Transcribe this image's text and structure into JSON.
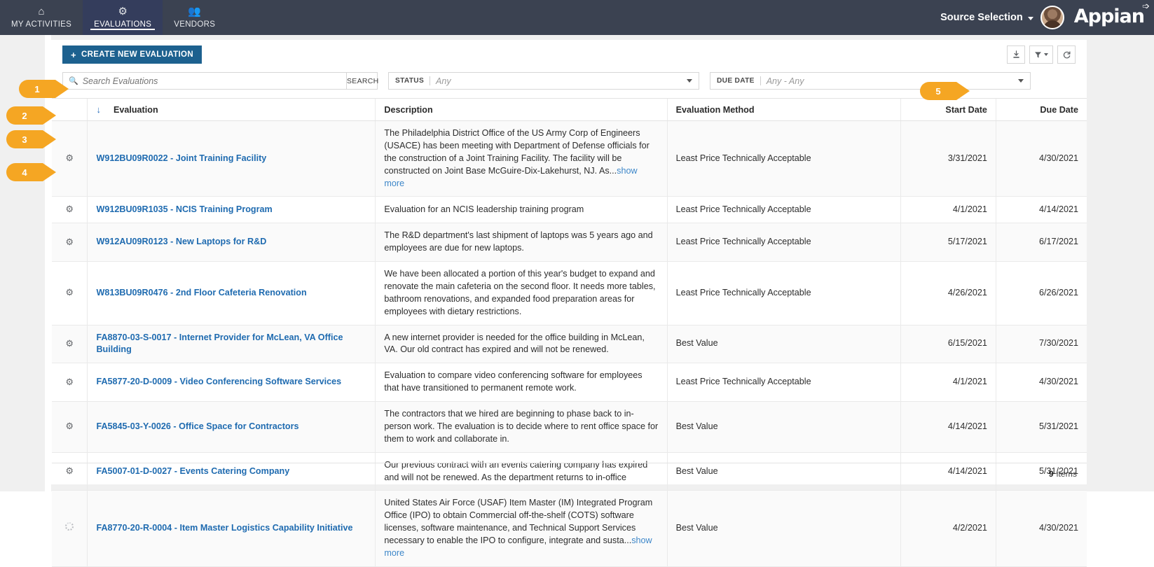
{
  "topnav": {
    "tabs": [
      {
        "label": "MY ACTIVITIES",
        "icon": "home-icon",
        "glyph": "⌂",
        "active": false
      },
      {
        "label": "EVALUATIONS",
        "icon": "gear-icon",
        "glyph": "⚙",
        "active": true
      },
      {
        "label": "VENDORS",
        "icon": "people-icon",
        "glyph": "👥",
        "active": false
      }
    ],
    "source_selection": "Source Selection",
    "brand": "Appian"
  },
  "toolbar": {
    "create_label": "CREATE NEW EVALUATION",
    "create_plus": "+",
    "export_icon": "download-icon",
    "filter_icon": "filter-icon",
    "refresh_icon": "refresh-icon"
  },
  "search": {
    "placeholder": "Search Evaluations",
    "value": "",
    "button_label": "SEARCH",
    "icon": "search-icon"
  },
  "filters": {
    "status": {
      "label": "STATUS",
      "value": "Any"
    },
    "due_date": {
      "label": "DUE DATE",
      "value": "Any - Any"
    }
  },
  "table": {
    "columns": [
      {
        "key": "gear",
        "label": ""
      },
      {
        "key": "evaluation",
        "label": "Evaluation"
      },
      {
        "key": "description",
        "label": "Description"
      },
      {
        "key": "method",
        "label": "Evaluation Method"
      },
      {
        "key": "start",
        "label": "Start Date"
      },
      {
        "key": "due",
        "label": "Due Date"
      }
    ],
    "sort_indicator": "↓",
    "show_more_label": "show more",
    "rows": [
      {
        "row_icon": "gear-icon",
        "name": "W912BU09R0022 - Joint Training Facility",
        "description": "The Philadelphia District Office of the US Army Corp of Engineers (USACE) has been meeting with Department of Defense officials for the construction of a Joint Training Facility. The facility will be constructed on Joint Base McGuire-Dix-Lakehurst, NJ. As...",
        "truncated": true,
        "method": "Least Price Technically Acceptable",
        "start": "3/31/2021",
        "due": "4/30/2021"
      },
      {
        "row_icon": "gear-icon",
        "name": "W912BU09R1035 - NCIS Training Program",
        "description": "Evaluation for an NCIS leadership training program",
        "truncated": false,
        "method": "Least Price Technically Acceptable",
        "start": "4/1/2021",
        "due": "4/14/2021"
      },
      {
        "row_icon": "gear-icon",
        "name": "W912AU09R0123 - New Laptops for R&D",
        "description": "The R&D department's last shipment of laptops was 5 years ago and employees are due for new laptops.",
        "truncated": false,
        "method": "Least Price Technically Acceptable",
        "start": "5/17/2021",
        "due": "6/17/2021"
      },
      {
        "row_icon": "gear-icon",
        "name": "W813BU09R0476 - 2nd Floor Cafeteria Renovation",
        "description": "We have been allocated a portion of this year's budget to expand and renovate the main cafeteria on the second floor. It needs more tables, bathroom renovations, and expanded food preparation areas for employees with dietary restrictions.",
        "truncated": false,
        "method": "Least Price Technically Acceptable",
        "start": "4/26/2021",
        "due": "6/26/2021"
      },
      {
        "row_icon": "gear-icon",
        "name": "FA8870-03-S-0017 - Internet Provider for McLean, VA Office Building",
        "description": "A new internet provider is needed for the office building in McLean, VA. Our old contract has expired and will not be renewed.",
        "truncated": false,
        "method": "Best Value",
        "start": "6/15/2021",
        "due": "7/30/2021"
      },
      {
        "row_icon": "gear-icon",
        "name": "FA5877-20-D-0009 - Video Conferencing Software Services",
        "description": "Evaluation to compare video conferencing software for employees that have transitioned to permanent remote work.",
        "truncated": false,
        "method": "Least Price Technically Acceptable",
        "start": "4/1/2021",
        "due": "4/30/2021"
      },
      {
        "row_icon": "gear-icon",
        "name": "FA5845-03-Y-0026 - Office Space for Contractors",
        "description": "The contractors that we hired are beginning to phase back to in-person work. The evaluation is to decide where to rent office space for them to work and collaborate in.",
        "truncated": false,
        "method": "Best Value",
        "start": "4/14/2021",
        "due": "5/31/2021"
      },
      {
        "row_icon": "gear-icon",
        "name": "FA5007-01-D-0027 - Events Catering Company",
        "description": "Our previous contract with an events catering company has expired and will not be renewed. As the department returns to in-office",
        "truncated": false,
        "method": "Best Value",
        "start": "4/14/2021",
        "due": "5/31/2021"
      },
      {
        "row_icon": "loading-spinner-icon",
        "name": "FA8770-20-R-0004 - Item Master Logistics Capability Initiative",
        "description": "United States Air Force (USAF) Item Master (IM) Integrated Program Office (IPO) to obtain Commercial off-the-shelf (COTS) software licenses, software maintenance, and Technical Support Services necessary to enable the IPO to configure, integrate and susta...",
        "truncated": true,
        "method": "Best Value",
        "start": "4/2/2021",
        "due": "4/30/2021"
      }
    ],
    "footer_count": "9",
    "footer_label": "items"
  },
  "callouts": [
    {
      "number": "1"
    },
    {
      "number": "2"
    },
    {
      "number": "3"
    },
    {
      "number": "4"
    },
    {
      "number": "5"
    }
  ],
  "colors": {
    "nav_bg": "#3b4251",
    "nav_active": "#343d5c",
    "primary_button": "#1d618f",
    "link": "#1f6bb0",
    "callout": "#f5a623"
  }
}
